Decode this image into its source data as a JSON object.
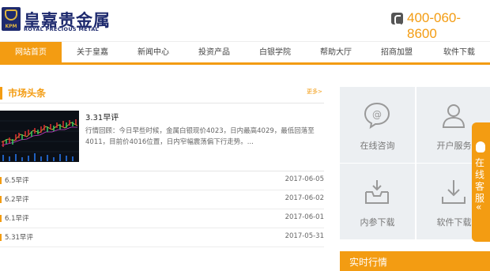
{
  "brand": {
    "logo_text": "KPM",
    "name_cn": "皇嘉贵金属",
    "name_en": "ROYAL PRECIOUS METAL"
  },
  "header": {
    "phone_icon": "phone-icon",
    "phone": "400-060-8600"
  },
  "nav": {
    "items": [
      {
        "label": "网站首页",
        "active": true
      },
      {
        "label": "关于皇嘉"
      },
      {
        "label": "新闻中心"
      },
      {
        "label": "投资产品"
      },
      {
        "label": "白银学院"
      },
      {
        "label": "帮助大厅"
      },
      {
        "label": "招商加盟"
      },
      {
        "label": "软件下载"
      }
    ]
  },
  "market_news": {
    "title": "市场头条",
    "more": "更多>",
    "featured": {
      "title": "3.31早评",
      "excerpt": "行情回顾：今日早些时候，金属白银现价4023，日内最高4029，最低回落至4011，目前价4016位置，日内窄幅震荡偏下行走势。..."
    },
    "items": [
      {
        "title": "6.5早评",
        "date": "2017-06-05"
      },
      {
        "title": "6.2早评",
        "date": "2017-06-02"
      },
      {
        "title": "6.1早评",
        "date": "2017-06-01"
      },
      {
        "title": "5.31早评",
        "date": "2017-05-31"
      }
    ]
  },
  "services": [
    {
      "label": "在线咨询",
      "icon": "chat-bubble-icon"
    },
    {
      "label": "开户服务",
      "icon": "user-icon"
    },
    {
      "label": "内参下载",
      "icon": "inbox-icon"
    },
    {
      "label": "软件下载",
      "icon": "download-icon"
    }
  ],
  "side_tab": {
    "label": "在线客服",
    "chevron": "«"
  },
  "quotes": {
    "title": "实时行情"
  },
  "colors": {
    "accent": "#f39c12",
    "brand": "#1e2a6e"
  }
}
